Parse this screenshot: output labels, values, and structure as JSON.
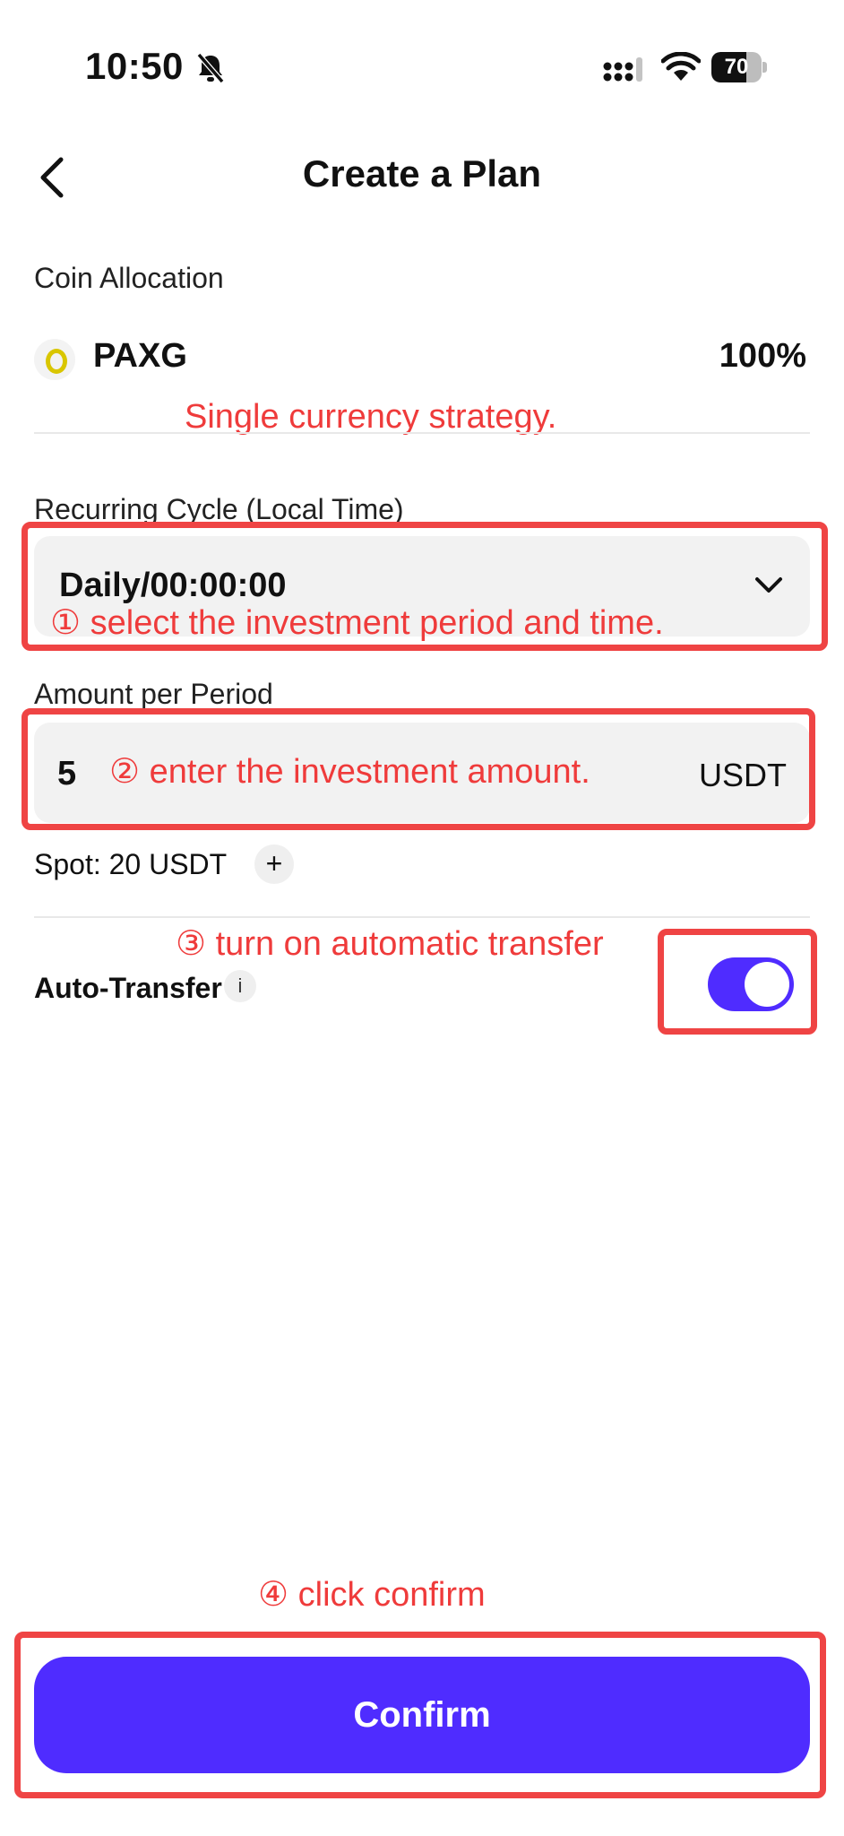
{
  "status_bar": {
    "time": "10:50",
    "battery": "70",
    "battery_level": 0.7
  },
  "header": {
    "title": "Create a Plan",
    "back_icon": "chevron-left-icon"
  },
  "allocation": {
    "label": "Coin Allocation",
    "coin": "PAXG",
    "percent": "100%"
  },
  "cycle": {
    "label": "Recurring Cycle (Local Time)",
    "value": "Daily/00:00:00"
  },
  "amount": {
    "label": "Amount per Period",
    "value": "5",
    "unit": "USDT"
  },
  "spot": {
    "text": "Spot: 20 USDT",
    "add": "+"
  },
  "auto_transfer": {
    "label": "Auto-Transfer",
    "info": "i",
    "enabled": true
  },
  "confirm": {
    "label": "Confirm"
  },
  "annotations": {
    "strategy": "Single currency strategy.",
    "step1": "① select the investment period and time.",
    "step2": "② enter the investment amount.",
    "step3": "③ turn on automatic transfer",
    "step4": "④ click confirm"
  },
  "colors": {
    "accent": "#4f2cff",
    "annotation": "#ef4444",
    "coin": "#d9c600"
  }
}
